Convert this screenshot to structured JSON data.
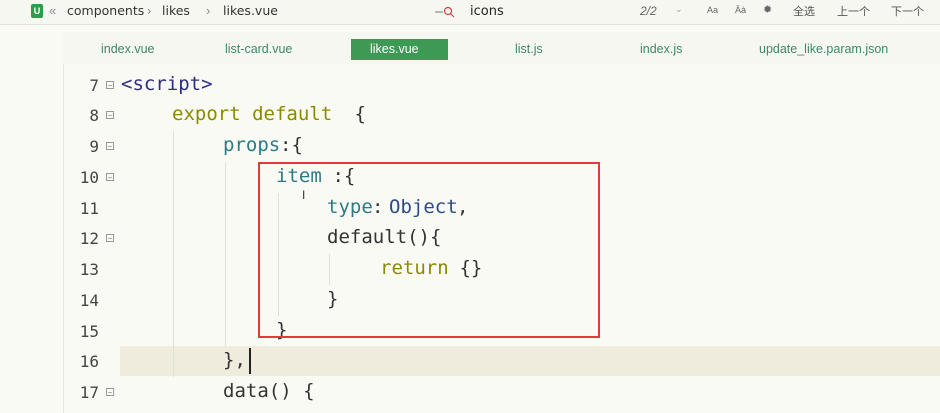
{
  "breadcrumb": {
    "app_badge": "U",
    "items": [
      "components",
      "likes",
      "likes.vue"
    ]
  },
  "find": {
    "query": "icons",
    "count": "2/2",
    "option_case": "Aa",
    "option_word": "Äà",
    "select_all": "全选",
    "prev": "上一个",
    "next": "下一个"
  },
  "tabs": [
    {
      "label": "index.vue",
      "active": false
    },
    {
      "label": "list-card.vue",
      "active": false
    },
    {
      "label": "likes.vue",
      "active": true
    },
    {
      "label": "list.js",
      "active": false
    },
    {
      "label": "index.js",
      "active": false
    },
    {
      "label": "update_like.param.json",
      "active": false
    }
  ],
  "code_lines": [
    {
      "num": "7",
      "fold": true
    },
    {
      "num": "8",
      "fold": true
    },
    {
      "num": "9",
      "fold": true
    },
    {
      "num": "10",
      "fold": true
    },
    {
      "num": "11",
      "fold": false
    },
    {
      "num": "12",
      "fold": true
    },
    {
      "num": "13",
      "fold": false
    },
    {
      "num": "14",
      "fold": false
    },
    {
      "num": "15",
      "fold": false
    },
    {
      "num": "16",
      "fold": false
    },
    {
      "num": "17",
      "fold": true
    }
  ],
  "code": {
    "l7": "<script>",
    "l8_kw": "export default",
    "l8_punc": " {",
    "l9_prop": "props",
    "l9_punc": ":{",
    "l10_prop": "item",
    "l10_punc": " :{",
    "l11_prop": "type",
    "l11_punc": ":",
    "l11_type": "Object",
    "l11_end": ",",
    "l12": "default(){",
    "l13_kw": "return",
    "l13_punc": " {}",
    "l14": "}",
    "l15": "}",
    "l16": "},",
    "l17": "data() {"
  }
}
